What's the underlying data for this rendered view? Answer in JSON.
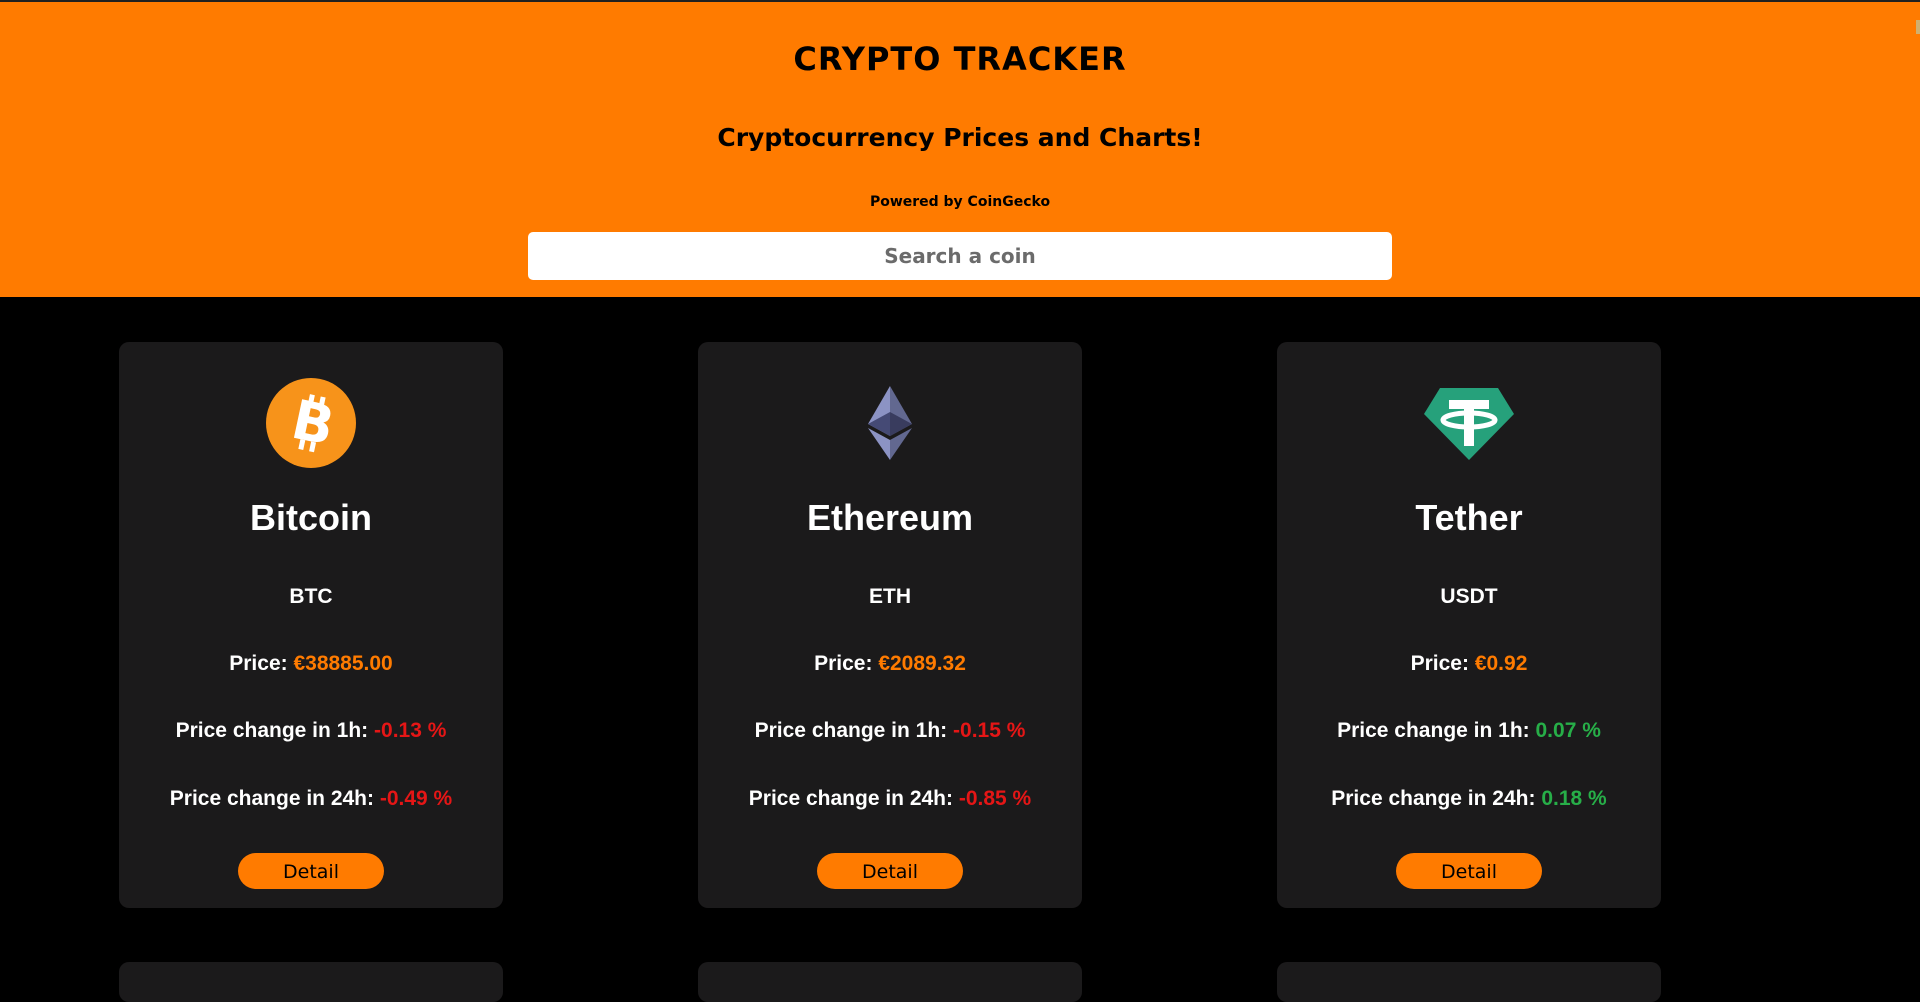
{
  "header": {
    "title": "CRYPTO TRACKER",
    "subtitle": "Cryptocurrency Prices and Charts!",
    "powered_by": "Powered by CoinGecko",
    "search_placeholder": "Search a coin"
  },
  "colors": {
    "header_bg": "#ff7b00",
    "page_bg": "#000000",
    "card_bg": "#1b1a1b",
    "price": "#ff7b00",
    "negative": "#e51616",
    "positive": "#27ae48"
  },
  "labels": {
    "price": "Price:",
    "change_1h": "Price change in 1h:",
    "change_24h": "Price change in 24h:",
    "detail": "Detail"
  },
  "coins": [
    {
      "name": "Bitcoin",
      "symbol": "BTC",
      "icon": "bitcoin-icon",
      "price": "€38885.00",
      "change_1h": "-0.13 %",
      "change_24h": "-0.49 %"
    },
    {
      "name": "Ethereum",
      "symbol": "ETH",
      "icon": "ethereum-icon",
      "price": "€2089.32",
      "change_1h": "-0.15 %",
      "change_24h": "-0.85 %"
    },
    {
      "name": "Tether",
      "symbol": "USDT",
      "icon": "tether-icon",
      "price": "€0.92",
      "change_1h": "0.07 %",
      "change_24h": "0.18 %"
    }
  ]
}
